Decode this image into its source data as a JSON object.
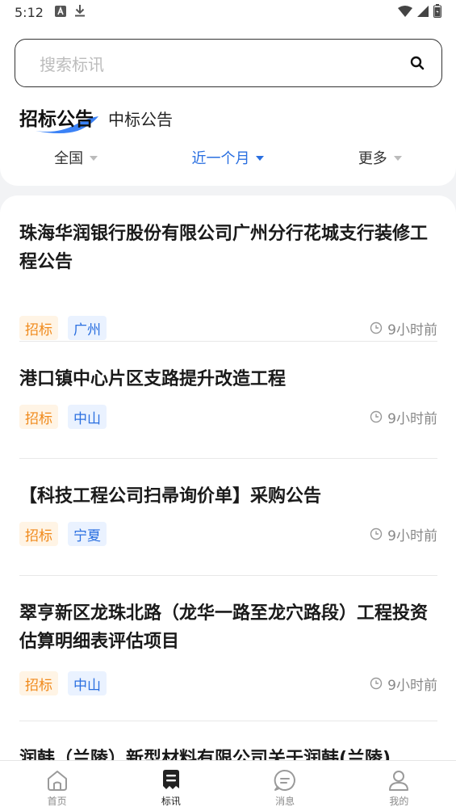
{
  "status_bar": {
    "time": "5:12"
  },
  "search": {
    "placeholder": "搜索标讯"
  },
  "tabs": [
    {
      "label": "招标公告",
      "active": true
    },
    {
      "label": "中标公告",
      "active": false
    }
  ],
  "filters": [
    {
      "label": "全国",
      "active": false
    },
    {
      "label": "近一个月",
      "active": true
    },
    {
      "label": "更多",
      "active": false
    }
  ],
  "items": [
    {
      "title": "珠海华润银行股份有限公司广州分行花城支行装修工程公告",
      "type_tag": "招标",
      "region_tag": "广州",
      "time": "9小时前"
    },
    {
      "title": "港口镇中心片区支路提升改造工程",
      "type_tag": "招标",
      "region_tag": "中山",
      "time": "9小时前"
    },
    {
      "title": "【科技工程公司扫帚询价单】采购公告",
      "type_tag": "招标",
      "region_tag": "宁夏",
      "time": "9小时前"
    },
    {
      "title": "翠亨新区龙珠北路（龙华一路至龙穴路段）工程投资估算明细表评估项目",
      "type_tag": "招标",
      "region_tag": "中山",
      "time": "9小时前"
    },
    {
      "title": "润韩（兰陵）新型材料有限公司关于润韩(兰陵)"
    }
  ],
  "bottom_nav": [
    {
      "label": "首页",
      "icon": "home-icon",
      "active": false
    },
    {
      "label": "标讯",
      "icon": "document-icon",
      "active": true
    },
    {
      "label": "消息",
      "icon": "message-icon",
      "active": false
    },
    {
      "label": "我的",
      "icon": "user-icon",
      "active": false
    }
  ],
  "colors": {
    "accent": "#2a6fe0",
    "type_tag": "#f08a1c",
    "swoosh": "#3b82f6"
  }
}
